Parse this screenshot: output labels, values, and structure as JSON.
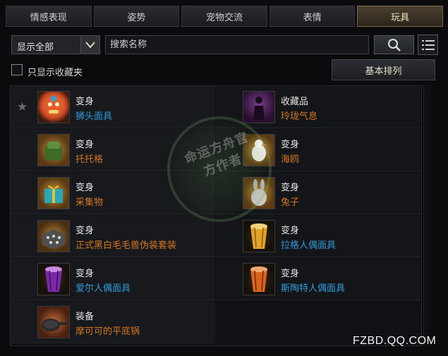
{
  "tabs": [
    "情感表现",
    "姿势",
    "宠物交流",
    "表情",
    "玩具"
  ],
  "active_tab_index": 4,
  "filter": {
    "selected": "显示全部"
  },
  "search": {
    "placeholder": "搜索名称",
    "value": ""
  },
  "favorites_only_label": "只显示收藏夹",
  "favorites_only_checked": false,
  "sort_button_label": "基本排列",
  "items": [
    {
      "type": "变身",
      "name": "狮头面具",
      "name_color": "#2e9bdc",
      "favorited": true,
      "icon": "lion-mask-icon",
      "col": 0,
      "row": 0
    },
    {
      "type": "收藏品",
      "name": "玲珑气息",
      "name_color": "#d2771e",
      "favorited": false,
      "icon": "shadow-figure-icon",
      "col": 1,
      "row": 0
    },
    {
      "type": "变身",
      "name": "托托格",
      "name_color": "#d2771e",
      "favorited": false,
      "icon": "tortoog-icon",
      "col": 0,
      "row": 1
    },
    {
      "type": "变身",
      "name": "海鸥",
      "name_color": "#d2771e",
      "favorited": false,
      "icon": "seagull-icon",
      "col": 1,
      "row": 1
    },
    {
      "type": "变身",
      "name": "采集物",
      "name_color": "#d2771e",
      "favorited": false,
      "icon": "gift-box-icon",
      "col": 0,
      "row": 2
    },
    {
      "type": "变身",
      "name": "兔子",
      "name_color": "#d2771e",
      "favorited": false,
      "icon": "rabbit-icon",
      "col": 1,
      "row": 2
    },
    {
      "type": "变身",
      "name": "正式黑白毛毛兽伪装套装",
      "name_color": "#d2771e",
      "favorited": false,
      "icon": "fur-costume-icon",
      "col": 0,
      "row": 3
    },
    {
      "type": "变身",
      "name": "拉格人偶面具",
      "name_color": "#2e9bdc",
      "favorited": false,
      "icon": "yellow-drum-mask-icon",
      "col": 1,
      "row": 3
    },
    {
      "type": "变身",
      "name": "爱尔人偶面具",
      "name_color": "#2e9bdc",
      "favorited": false,
      "icon": "purple-drum-mask-icon",
      "col": 0,
      "row": 4
    },
    {
      "type": "变身",
      "name": "斯陶特人偶面具",
      "name_color": "#2e9bdc",
      "favorited": false,
      "icon": "orange-drum-mask-icon",
      "col": 1,
      "row": 4
    },
    {
      "type": "装备",
      "name": "摩可可的平底锅",
      "name_color": "#d2771e",
      "favorited": false,
      "icon": "frying-pan-icon",
      "col": 0,
      "row": 5
    }
  ],
  "watermark_text": "命运方舟官方作者",
  "site_text": "FZBD.QQ.COM"
}
